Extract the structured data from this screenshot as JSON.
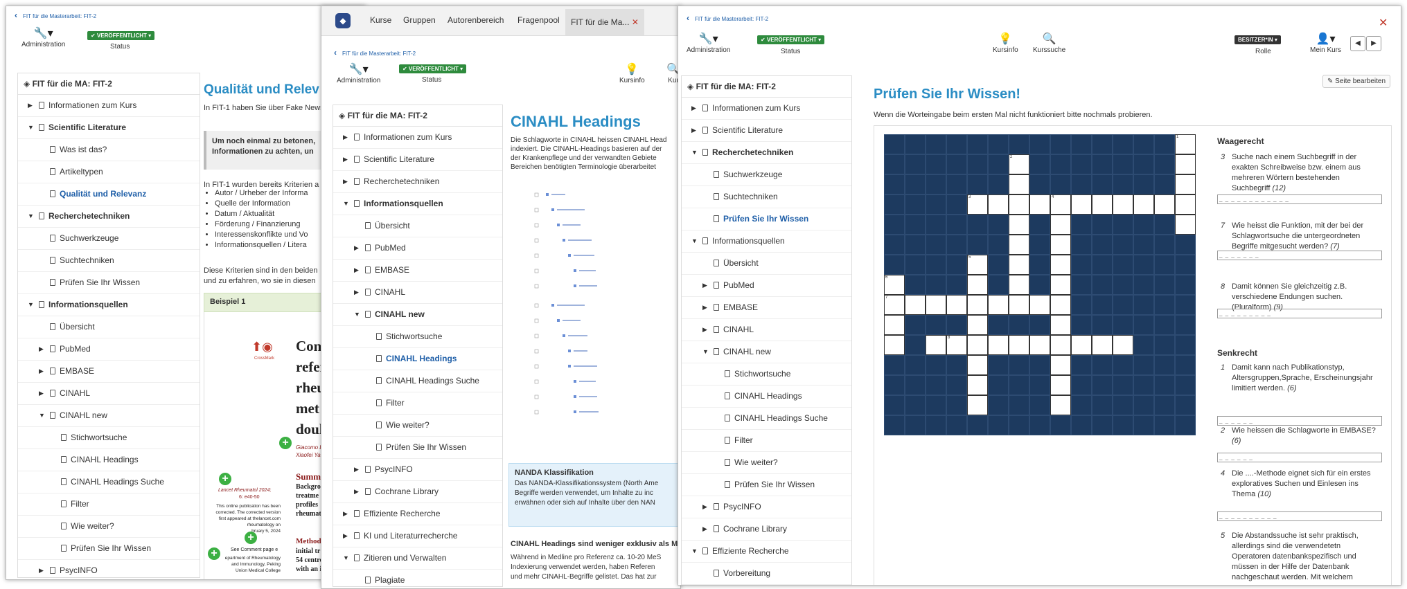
{
  "w1": {
    "breadcrumb": "FIT für die Masterarbeit: FIT-2",
    "admin": "Administration",
    "status_badge": "✔ VERÖFFENTLICHT ▾",
    "status": "Status",
    "tree_header": "FIT für die MA: FIT-2",
    "tree": [
      "Informationen zum Kurs",
      "Scientific Literature",
      "Was ist das?",
      "Artikeltypen",
      "Qualität und Relevanz",
      "Recherchetechniken",
      "Suchwerkzeuge",
      "Suchtechniken",
      "Prüfen Sie Ihr Wissen",
      "Informationsquellen",
      "Übersicht",
      "PubMed",
      "EMBASE",
      "CINAHL",
      "CINAHL new",
      "Stichwortsuche",
      "CINAHL Headings",
      "CINAHL Headings Suche",
      "Filter",
      "Wie weiter?",
      "Prüfen Sie Ihr Wissen",
      "PsycINFO"
    ],
    "title": "Qualität und Relev",
    "intro": "In FIT-1 haben Sie über Fake News",
    "box": "Um noch einmal zu betonen, Informationen zu achten, un",
    "p2": "In FIT-1 wurden bereits Kriterien a",
    "bullets": [
      "Autor / Urheber der Informa",
      "Quelle der Information",
      "Datum / Aktualität",
      "Förderung / Finanzierung",
      "Interessenskonflikte und Vo",
      "Informationsquellen / Litera"
    ],
    "p3a": "Diese Kriterien sind in den beiden",
    "p3b": "und zu erfahren, wo sie in diesen",
    "example": "Beispiel 1",
    "paper_title": [
      "Com",
      "refer",
      "rheu",
      "met",
      "doul"
    ],
    "crossmark": "CrossMark",
    "authors": [
      "Giacomo L",
      "Xiaofei Ya"
    ],
    "summary": "Summ",
    "summary_lines": [
      "Backgro",
      "treatme",
      "profiles",
      "rheumat"
    ],
    "lancet": "Lancet Rheumatol 2024;",
    "lancet2": "6: e40-50",
    "corr": [
      "This online publication has been",
      "corrected. The corrected version",
      "first appeared at thelancet.com",
      "rheumatology on",
      "bruary 5, 2024"
    ],
    "see": "See Comment page e",
    "dept": [
      "epartment of Rheumatology",
      "and Immunology, Peking",
      "Union Medical College"
    ],
    "methods": "Methods",
    "methods_lines": [
      "initial tr",
      "54 centre",
      "with an i"
    ]
  },
  "w2": {
    "nav": [
      "Kurse",
      "Gruppen",
      "Autorenbereich",
      "Fragenpool"
    ],
    "tab": "FIT für die Ma...",
    "tab_close": "✕",
    "breadcrumb": "FIT für die Masterarbeit: FIT-2",
    "admin": "Administration",
    "status_badge": "✔ VERÖFFENTLICHT ▾",
    "status": "Status",
    "kursinfo": "Kursinfo",
    "kur": "Kur",
    "tree_header": "FIT für die MA: FIT-2",
    "tree": [
      "Informationen zum Kurs",
      "Scientific Literature",
      "Recherchetechniken",
      "Informationsquellen",
      "Übersicht",
      "PubMed",
      "EMBASE",
      "CINAHL",
      "CINAHL new",
      "Stichwortsuche",
      "CINAHL Headings",
      "CINAHL Headings Suche",
      "Filter",
      "Wie weiter?",
      "Prüfen Sie Ihr Wissen",
      "PsycINFO",
      "Cochrane Library",
      "Effiziente Recherche",
      "KI und Literaturrecherche",
      "Zitieren und Verwalten",
      "Plagiate",
      "Zitieren"
    ],
    "title": "CINAHL Headings",
    "p1a": "Die Schlagworte in CINAHL heissen CINAHL Head",
    "p1b": "indexiert. Die CINAHL-Headings basieren auf der",
    "p1c": "der Krankenpflege und der verwandten Gebiete",
    "p1d": "Bereichen benötigten Terminologie überarbeitet",
    "nanda_title": "NANDA Klassifikation",
    "nanda_a": "Das NANDA-Klassifikationssystem (North Ame",
    "nanda_b": "Begriffe werden verwendet, um Inhalte zu inc",
    "nanda_c": "erwähnen oder sich auf Inhalte über den NAN",
    "sub_title": "CINAHL Headings sind weniger exklusiv als M",
    "sub_a": "Während in Medline pro Referenz ca. 10-20 MeS",
    "sub_b": "Indexierung verwendet werden, haben Referen",
    "sub_c": "und mehr CINAHL-Begriffe gelistet. Das hat zur"
  },
  "w3": {
    "breadcrumb": "FIT für die Masterarbeit: FIT-2",
    "close": "✕",
    "admin": "Administration",
    "status_badge": "✔ VERÖFFENTLICHT ▾",
    "status": "Status",
    "kursinfo": "Kursinfo",
    "kurssuche": "Kurssuche",
    "role_badge": "BESITZER*IN ▾",
    "role": "Rolle",
    "meinkurs": "Mein Kurs",
    "tree_header": "FIT für die MA: FIT-2",
    "tree": [
      "Informationen zum Kurs",
      "Scientific Literature",
      "Recherchetechniken",
      "Suchwerkzeuge",
      "Suchtechniken",
      "Prüfen Sie Ihr Wissen",
      "Informationsquellen",
      "Übersicht",
      "PubMed",
      "EMBASE",
      "CINAHL",
      "CINAHL new",
      "Stichwortsuche",
      "CINAHL Headings",
      "CINAHL Headings Suche",
      "Filter",
      "Wie weiter?",
      "Prüfen Sie Ihr Wissen",
      "PsycINFO",
      "Cochrane Library",
      "Effiziente Recherche",
      "Vorbereitung"
    ],
    "edit": "Seite bearbeiten",
    "title": "Prüfen Sie Ihr Wissen!",
    "note": "Wenn die Worteingabe beim ersten Mal nicht funktioniert bitte nochmals probieren.",
    "across": "Waagerecht",
    "down": "Senkrecht",
    "clues_across": [
      {
        "n": "3",
        "t": "Suche nach einem Suchbegriff in der exakten Schreibweise bzw. einem aus mehreren Wörtern bestehenden Suchbegriff",
        "len": "(12)",
        "blank": "_ _ _ _ _ _ _ _ _ _ _ _"
      },
      {
        "n": "7",
        "t": "Wie heisst die Funktion, mit der bei der Schlagwortsuche die untergeordneten Begriffe mitgesucht werden?",
        "len": "(7)",
        "blank": "_ _ _ _ _ _ _"
      },
      {
        "n": "8",
        "t": "Damit können Sie gleichzeitig z.B. verschiedene Endungen suchen. (Pluralform)",
        "len": "(9)",
        "blank": "_ _ _ _ _ _ _ _ _"
      }
    ],
    "clues_down": [
      {
        "n": "1",
        "t": "Damit kann nach Publikationstyp, Altersgruppen,Sprache, Erscheinungsjahr limitiert werden.",
        "len": "(6)",
        "blank": "_ _ _ _ _ _"
      },
      {
        "n": "2",
        "t": "Wie heissen die Schlagworte in EMBASE?",
        "len": "(6)",
        "blank": "_ _ _ _ _ _"
      },
      {
        "n": "4",
        "t": "Die ....-Methode eignet sich für ein erstes exploratives Suchen und Einlesen ins Thema",
        "len": "(10)",
        "blank": "_ _ _ _ _ _ _ _ _ _"
      },
      {
        "n": "5",
        "t": "Die Abstandssuche ist sehr praktisch, allerdings sind die verwendetetn Operatoren datenbankspezifisch und müssen in der Hilfe der Datenbank nachgeschaut werden. Mit welchem",
        "len": "",
        "blank": ""
      }
    ]
  }
}
